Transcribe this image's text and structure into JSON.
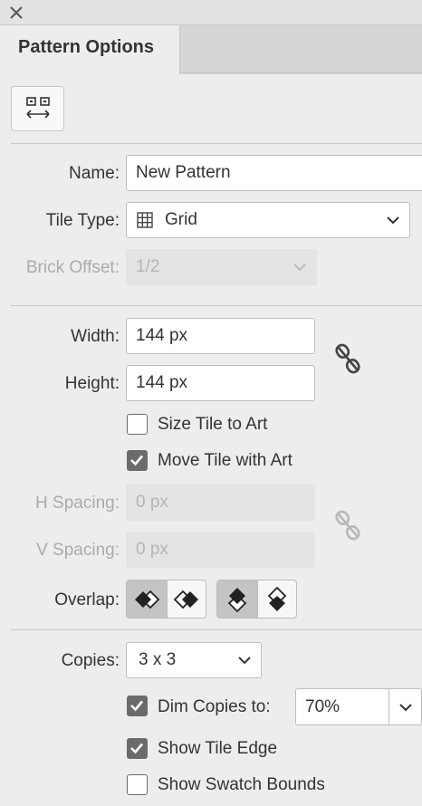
{
  "panel": {
    "title": "Pattern Options",
    "close_icon": "close-icon",
    "tile_tool_icon": "pattern-tile-tool-icon"
  },
  "name": {
    "label": "Name:",
    "value": "New Pattern"
  },
  "tile_type": {
    "label": "Tile Type:",
    "value": "Grid",
    "icon": "grid-icon"
  },
  "brick_offset": {
    "label": "Brick Offset:",
    "value": "1/2",
    "enabled": false
  },
  "width": {
    "label": "Width:",
    "value": "144 px"
  },
  "height": {
    "label": "Height:",
    "value": "144 px"
  },
  "size_link_icon": "broken-link-icon",
  "size_tile_to_art": {
    "label": "Size Tile to Art",
    "checked": false
  },
  "move_tile_with_art": {
    "label": "Move Tile with Art",
    "checked": true
  },
  "h_spacing": {
    "label": "H Spacing:",
    "value": "0 px",
    "enabled": false
  },
  "v_spacing": {
    "label": "V Spacing:",
    "value": "0 px",
    "enabled": false
  },
  "spacing_link_icon": "broken-link-icon",
  "overlap": {
    "label": "Overlap:",
    "horizontal_options": [
      "left-in-front",
      "right-in-front"
    ],
    "horizontal_selected": "left-in-front",
    "vertical_options": [
      "top-in-front",
      "bottom-in-front"
    ],
    "vertical_selected": "top-in-front"
  },
  "copies": {
    "label": "Copies:",
    "value": "3 x 3"
  },
  "dim_copies": {
    "label": "Dim Copies to:",
    "checked": true,
    "value": "70%"
  },
  "show_tile_edge": {
    "label": "Show Tile Edge",
    "checked": true
  },
  "show_swatch_bounds": {
    "label": "Show Swatch Bounds",
    "checked": false
  },
  "colors": {
    "panel_bg": "#ededed",
    "checkbox_on": "#6b6b6b",
    "selected_segment": "#c4c4c4"
  }
}
